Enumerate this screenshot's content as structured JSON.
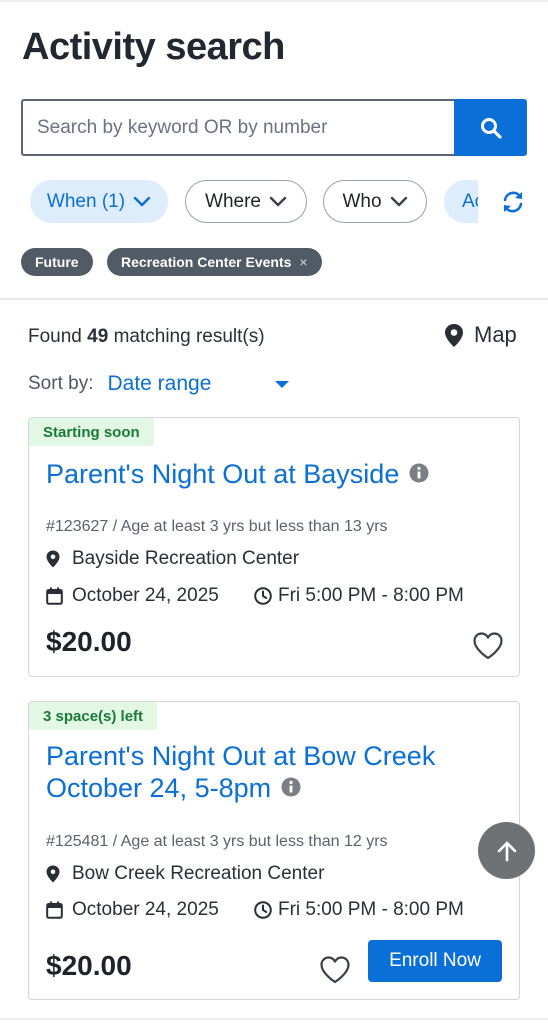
{
  "page": {
    "title": "Activity search"
  },
  "search": {
    "placeholder": "Search by keyword OR by number"
  },
  "filters": [
    {
      "label": "When (1)",
      "active": true
    },
    {
      "label": "Where",
      "active": false
    },
    {
      "label": "Who",
      "active": false
    },
    {
      "label": "Ac",
      "active": true
    }
  ],
  "tags": [
    {
      "label": "Future",
      "removable": false
    },
    {
      "label": "Recreation Center Events",
      "removable": true,
      "remove_symbol": "×"
    }
  ],
  "results": {
    "prefix": "Found",
    "count": "49",
    "suffix": "matching result(s)",
    "map_label": "Map"
  },
  "sort": {
    "label": "Sort by:",
    "value": "Date range"
  },
  "cards": [
    {
      "badge": "Starting soon",
      "title_lines": [
        "Parent's Night Out at Bayside"
      ],
      "meta": "#123627 / Age at least 3 yrs but less than 13 yrs",
      "location": "Bayside Recreation Center",
      "date": "October 24, 2025",
      "time": "Fri 5:00 PM - 8:00 PM",
      "price": "$20.00",
      "enroll_label": ""
    },
    {
      "badge": "3 space(s) left",
      "title_lines": [
        "Parent's Night Out at Bow Creek",
        "October 24, 5-8pm"
      ],
      "meta": "#125481 / Age at least 3 yrs but less than 12 yrs",
      "location": "Bow Creek Recreation Center",
      "date": "October 24, 2025",
      "time": "Fri 5:00 PM - 8:00 PM",
      "price": "$20.00",
      "enroll_label": "Enroll Now"
    }
  ],
  "colors": {
    "accent": "#0a6fd6",
    "badge_bg": "#e2f7e4",
    "badge_text": "#1a7a36",
    "tag_bg": "#505b66"
  },
  "icons": [
    "search-icon",
    "chevron-down-icon",
    "refresh-icon",
    "close-icon",
    "map-pin-icon",
    "info-icon",
    "calendar-icon",
    "clock-icon",
    "heart-icon",
    "arrow-up-icon"
  ]
}
